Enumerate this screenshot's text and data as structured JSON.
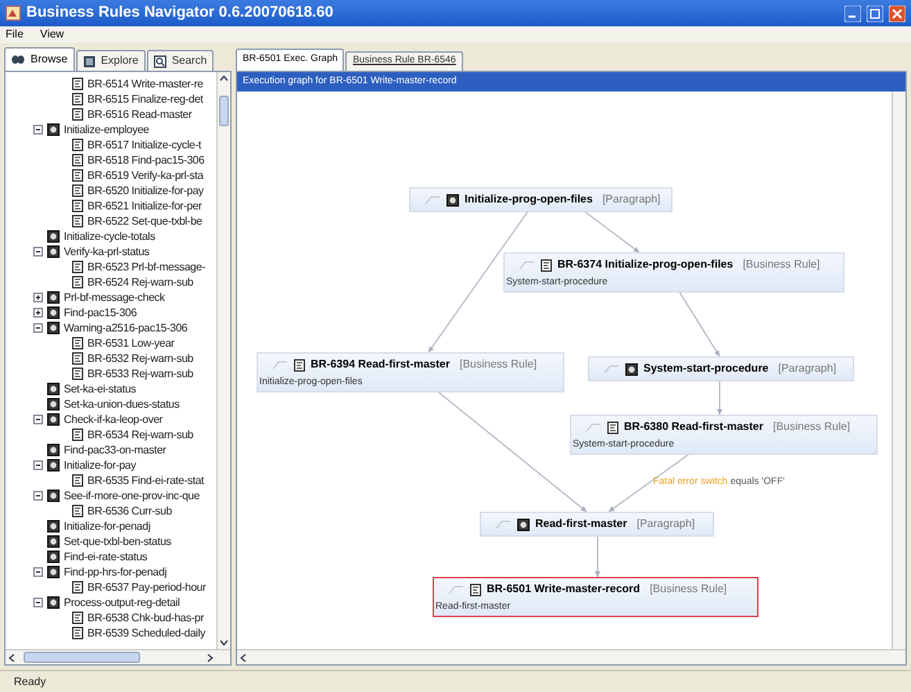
{
  "window": {
    "title": "Business Rules Navigator 0.6.20070618.60"
  },
  "menu": [
    "File",
    "View"
  ],
  "left_tabs": [
    {
      "label": "Browse",
      "selected": true,
      "kind": "browse"
    },
    {
      "label": "Explore",
      "selected": false,
      "kind": "explore"
    },
    {
      "label": "Search",
      "selected": false,
      "kind": "search"
    }
  ],
  "tree": [
    {
      "children": [
        {
          "kind": "rule",
          "label": "BR-6514 Write-master-re"
        },
        {
          "kind": "rule",
          "label": "BR-6515 Finalize-reg-det"
        },
        {
          "kind": "rule",
          "label": "BR-6516 Read-master"
        }
      ]
    },
    {
      "kind": "paragraph",
      "label": "Initialize-employee",
      "expanded": true,
      "children": [
        {
          "kind": "rule",
          "label": "BR-6517 Initialize-cycle-t"
        },
        {
          "kind": "rule",
          "label": "BR-6518 Find-pac15-306"
        },
        {
          "kind": "rule",
          "label": "BR-6519 Verify-ka-prl-sta"
        },
        {
          "kind": "rule",
          "label": "BR-6520 Initialize-for-pay"
        },
        {
          "kind": "rule",
          "label": "BR-6521 Initialize-for-per"
        },
        {
          "kind": "rule",
          "label": "BR-6522 Set-que-txbl-be"
        }
      ]
    },
    {
      "kind": "paragraph",
      "label": "Initialize-cycle-totals"
    },
    {
      "kind": "paragraph",
      "label": "Verify-ka-prl-status",
      "expanded": true,
      "children": [
        {
          "kind": "rule",
          "label": "BR-6523 Prl-bf-message-"
        },
        {
          "kind": "rule",
          "label": "BR-6524 Rej-warn-sub"
        }
      ]
    },
    {
      "kind": "paragraph",
      "label": "Prl-bf-message-check",
      "expanded": false
    },
    {
      "kind": "paragraph",
      "label": "Find-pac15-306",
      "expanded": false
    },
    {
      "kind": "paragraph",
      "label": "Warning-a2516-pac15-306",
      "expanded": true,
      "children": [
        {
          "kind": "rule",
          "label": "BR-6531 Low-year"
        },
        {
          "kind": "rule",
          "label": "BR-6532 Rej-warn-sub"
        },
        {
          "kind": "rule",
          "label": "BR-6533 Rej-warn-sub"
        }
      ]
    },
    {
      "kind": "paragraph",
      "label": "Set-ka-ei-status"
    },
    {
      "kind": "paragraph",
      "label": "Set-ka-union-dues-status"
    },
    {
      "kind": "paragraph",
      "label": "Check-if-ka-leop-over",
      "expanded": true,
      "children": [
        {
          "kind": "rule",
          "label": "BR-6534 Rej-warn-sub"
        }
      ]
    },
    {
      "kind": "paragraph",
      "label": "Find-pac33-on-master"
    },
    {
      "kind": "paragraph",
      "label": "Initialize-for-pay",
      "expanded": true,
      "children": [
        {
          "kind": "rule",
          "label": "BR-6535 Find-ei-rate-stat"
        }
      ]
    },
    {
      "kind": "paragraph",
      "label": "See-if-more-one-prov-inc-que",
      "expanded": true,
      "children": [
        {
          "kind": "rule",
          "label": "BR-6536 Curr-sub"
        }
      ]
    },
    {
      "kind": "paragraph",
      "label": "Initialize-for-penadj"
    },
    {
      "kind": "paragraph",
      "label": "Set-que-txbl-ben-status"
    },
    {
      "kind": "paragraph",
      "label": "Find-ei-rate-status"
    },
    {
      "kind": "paragraph",
      "label": "Find-pp-hrs-for-penadj",
      "expanded": true,
      "children": [
        {
          "kind": "rule",
          "label": "BR-6537 Pay-period-hour"
        }
      ]
    },
    {
      "kind": "paragraph",
      "label": "Process-output-reg-detail",
      "expanded": true,
      "children": [
        {
          "kind": "rule",
          "label": "BR-6538 Chk-bud-has-pr"
        },
        {
          "kind": "rule",
          "label": "BR-6539 Scheduled-daily"
        }
      ]
    }
  ],
  "right_tabs": [
    {
      "label": "BR-6501 Exec. Graph",
      "selected": true
    },
    {
      "label": "Business Rule BR-6546",
      "selected": false
    }
  ],
  "graph": {
    "header": "Execution graph for BR-6501 Write-master-record",
    "nodes": [
      {
        "kind": "paragraph",
        "title": "Initialize-prog-open-files",
        "type": "[Paragraph]",
        "selected": false
      },
      {
        "kind": "rule",
        "title": "BR-6374 Initialize-prog-open-files",
        "type": "[Business Rule]",
        "caller": "System-start-procedure",
        "selected": false
      },
      {
        "kind": "rule",
        "title": "BR-6394 Read-first-master",
        "type": "[Business Rule]",
        "caller": "Initialize-prog-open-files",
        "selected": false
      },
      {
        "kind": "paragraph",
        "title": "System-start-procedure",
        "type": "[Paragraph]",
        "selected": false
      },
      {
        "kind": "rule",
        "title": "BR-6380 Read-first-master",
        "type": "[Business Rule]",
        "caller": "System-start-procedure",
        "selected": false
      },
      {
        "kind": "paragraph",
        "title": "Read-first-master",
        "type": "[Paragraph]",
        "selected": false
      },
      {
        "kind": "rule",
        "title": "BR-6501 Write-master-record",
        "type": "[Business Rule]",
        "caller": "Read-first-master",
        "selected": true
      }
    ],
    "condition": {
      "variable": "Fatal error switch",
      "operator": "equals 'OFF'"
    }
  },
  "status_bar": "Ready"
}
